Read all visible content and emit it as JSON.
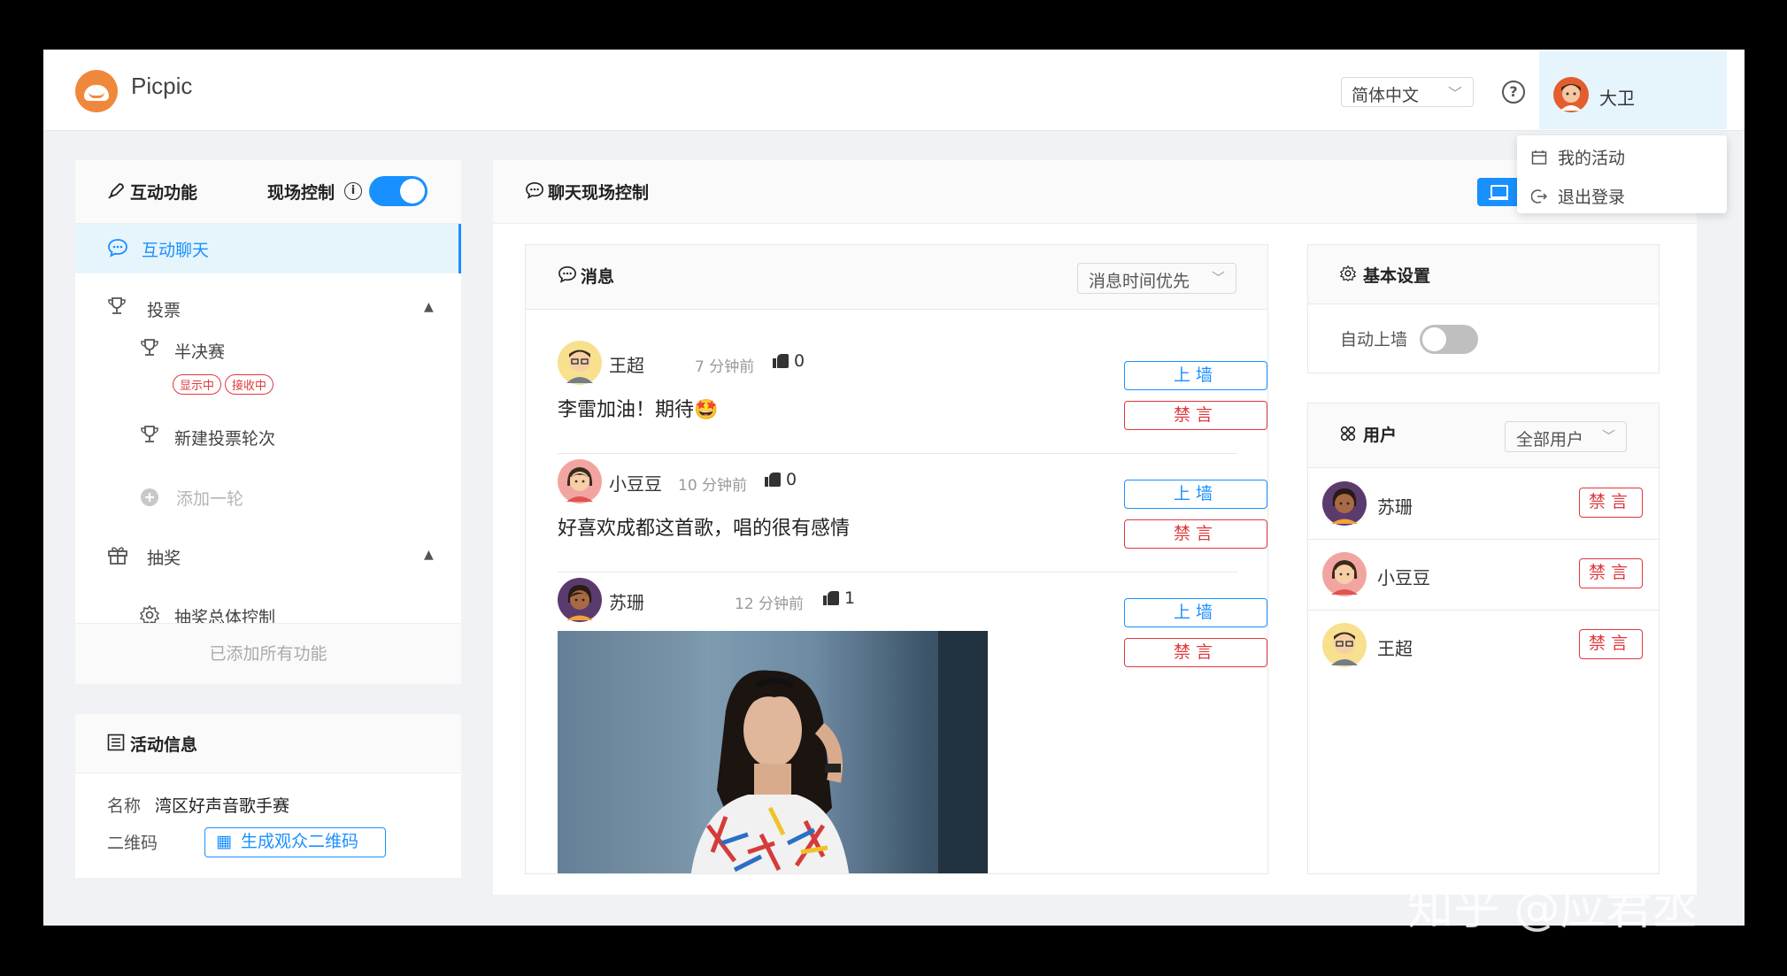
{
  "header": {
    "brand": "Picpic",
    "language": "简体中文",
    "user_name": "大卫"
  },
  "user_menu": {
    "items": [
      {
        "label": "我的活动",
        "icon": "calendar-icon"
      },
      {
        "label": "退出登录",
        "icon": "logout-icon"
      }
    ]
  },
  "sidebar": {
    "title": "互动功能",
    "control_label": "现场控制",
    "control_enabled": true,
    "items": [
      {
        "label": "互动聊天",
        "icon": "chat-icon",
        "active": true
      },
      {
        "label": "投票",
        "icon": "trophy-icon"
      },
      {
        "label": "半决赛",
        "icon": "trophy-icon",
        "tags": [
          "显示中",
          "接收中"
        ]
      },
      {
        "label": "新建投票轮次",
        "icon": "trophy-icon"
      },
      {
        "label": "添加一轮",
        "icon": "plus-circle-icon"
      },
      {
        "label": "抽奖",
        "icon": "gift-icon"
      },
      {
        "label": "抽奖总体控制",
        "icon": "gear-icon"
      }
    ],
    "footer": "已添加所有功能"
  },
  "activity_info": {
    "title": "活动信息",
    "name_label": "名称",
    "name_value": "湾区好声音歌手赛",
    "qr_label": "二维码",
    "qr_button": "生成观众二维码"
  },
  "main": {
    "title": "聊天现场控制"
  },
  "messages": {
    "title": "消息",
    "sort": "消息时间优先",
    "wall_label": "上墙",
    "ban_label": "禁言",
    "items": [
      {
        "name": "王超",
        "time": "7 分钟前",
        "likes": "0",
        "text": "李雷加油！期待🤩"
      },
      {
        "name": "小豆豆",
        "time": "10 分钟前",
        "likes": "0",
        "text": "好喜欢成都这首歌，唱的很有感情"
      },
      {
        "name": "苏珊",
        "time": "12 分钟前",
        "likes": "1",
        "text": ""
      }
    ]
  },
  "settings": {
    "title": "基本设置",
    "auto_wall_label": "自动上墙",
    "auto_wall_enabled": false
  },
  "users": {
    "title": "用户",
    "filter": "全部用户",
    "ban_label": "禁言",
    "items": [
      {
        "name": "苏珊"
      },
      {
        "name": "小豆豆"
      },
      {
        "name": "王超"
      }
    ]
  },
  "watermark": "知乎 @应君丞"
}
